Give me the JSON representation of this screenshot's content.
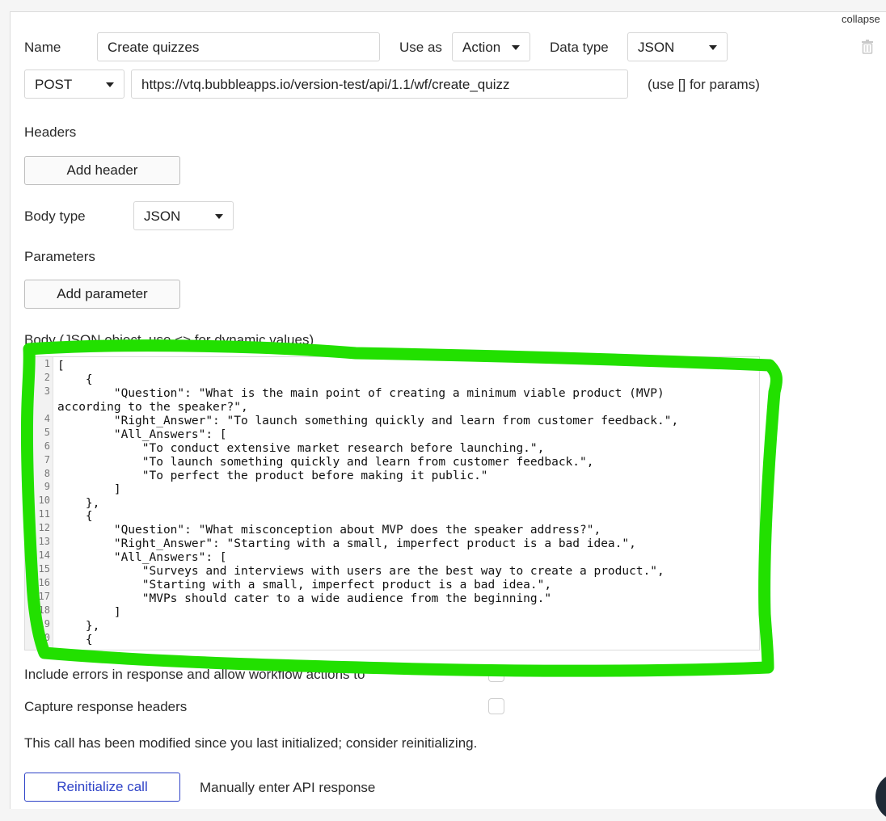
{
  "header": {
    "collapse_label": "collapse"
  },
  "call": {
    "name_label": "Name",
    "name_value": "Create quizzes",
    "use_as_label": "Use as",
    "use_as_value": "Action",
    "data_type_label": "Data type",
    "data_type_value": "JSON",
    "method_value": "POST",
    "url_value": "https://vtq.bubbleapps.io/version-test/api/1.1/wf/create_quizz",
    "url_hint": "(use [] for params)"
  },
  "headers_section": {
    "title": "Headers",
    "add_button": "Add header"
  },
  "body_type": {
    "label": "Body type",
    "value": "JSON"
  },
  "parameters_section": {
    "title": "Parameters",
    "add_button": "Add parameter"
  },
  "body_section": {
    "label": "Body (JSON object, use <> for dynamic values)",
    "line_numbers": [
      "1",
      "2",
      "3",
      "",
      "4",
      "5",
      "6",
      "7",
      "8",
      "9",
      "10",
      "11",
      "12",
      "13",
      "14",
      "15",
      "16",
      "17",
      "18",
      "19",
      "20"
    ],
    "code": "[\n    {\n        \"Question\": \"What is the main point of creating a minimum viable product (MVP)\naccording to the speaker?\",\n        \"Right_Answer\": \"To launch something quickly and learn from customer feedback.\",\n        \"All_Answers\": [\n            \"To conduct extensive market research before launching.\",\n            \"To launch something quickly and learn from customer feedback.\",\n            \"To perfect the product before making it public.\"\n        ]\n    },\n    {\n        \"Question\": \"What misconception about MVP does the speaker address?\",\n        \"Right_Answer\": \"Starting with a small, imperfect product is a bad idea.\",\n        \"All_Answers\": [\n            \"Surveys and interviews with users are the best way to create a product.\",\n            \"Starting with a small, imperfect product is a bad idea.\",\n            \"MVPs should cater to a wide audience from the beginning.\"\n        ]\n    },\n    {"
  },
  "options": {
    "include_errors_label": "Include errors in response and allow workflow actions to",
    "capture_headers_label": "Capture response headers"
  },
  "status": {
    "modified_message": "This call has been modified since you last initialized; consider reinitializing."
  },
  "actions": {
    "reinitialize_button": "Reinitialize call",
    "manual_response_link": "Manually enter API response"
  },
  "colors": {
    "highlight": "#22e000",
    "primary": "#2e42c7"
  },
  "icons": {
    "dropdown": "caret-down-icon",
    "delete": "trash-icon"
  }
}
